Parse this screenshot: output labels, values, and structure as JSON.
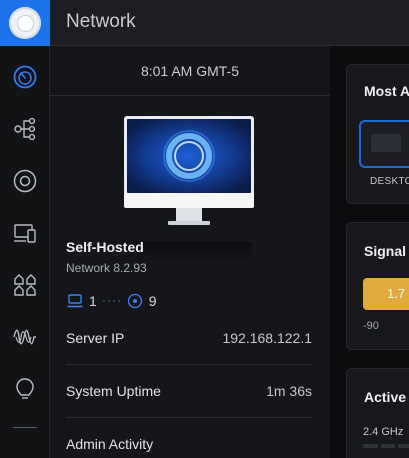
{
  "header": {
    "title": "Network"
  },
  "sidebar": {
    "items": [
      {
        "name": "dashboard",
        "icon": "dashboard-icon",
        "active": true
      },
      {
        "name": "topology",
        "icon": "topology-icon"
      },
      {
        "name": "devices",
        "icon": "devices-icon"
      },
      {
        "name": "client-devices",
        "icon": "client-devices-icon"
      },
      {
        "name": "ports",
        "icon": "ports-icon"
      },
      {
        "name": "insights",
        "icon": "insights-icon"
      },
      {
        "name": "alerts",
        "icon": "alerts-icon"
      }
    ]
  },
  "panel": {
    "time": "8:01 AM GMT-5",
    "site_name": "Self-Hosted",
    "version": "Network 8.2.93",
    "wired_count": "1",
    "wireless_count": "9",
    "server_ip_label": "Server IP",
    "server_ip_value": "192.168.122.1",
    "uptime_label": "System Uptime",
    "uptime_value": "1m 36s",
    "admin_activity_label": "Admin Activity"
  },
  "right": {
    "most_active_title": "Most A",
    "client_label": "DESKTO",
    "signal_title": "Signal S",
    "signal_value": "1.7",
    "signal_min": "-90",
    "active_title": "Active C",
    "band_label": "2.4 GHz"
  },
  "colors": {
    "accent": "#1a73e8",
    "signal": "#e0a93e",
    "background": "#0d0e10",
    "panel": "#15161a"
  }
}
